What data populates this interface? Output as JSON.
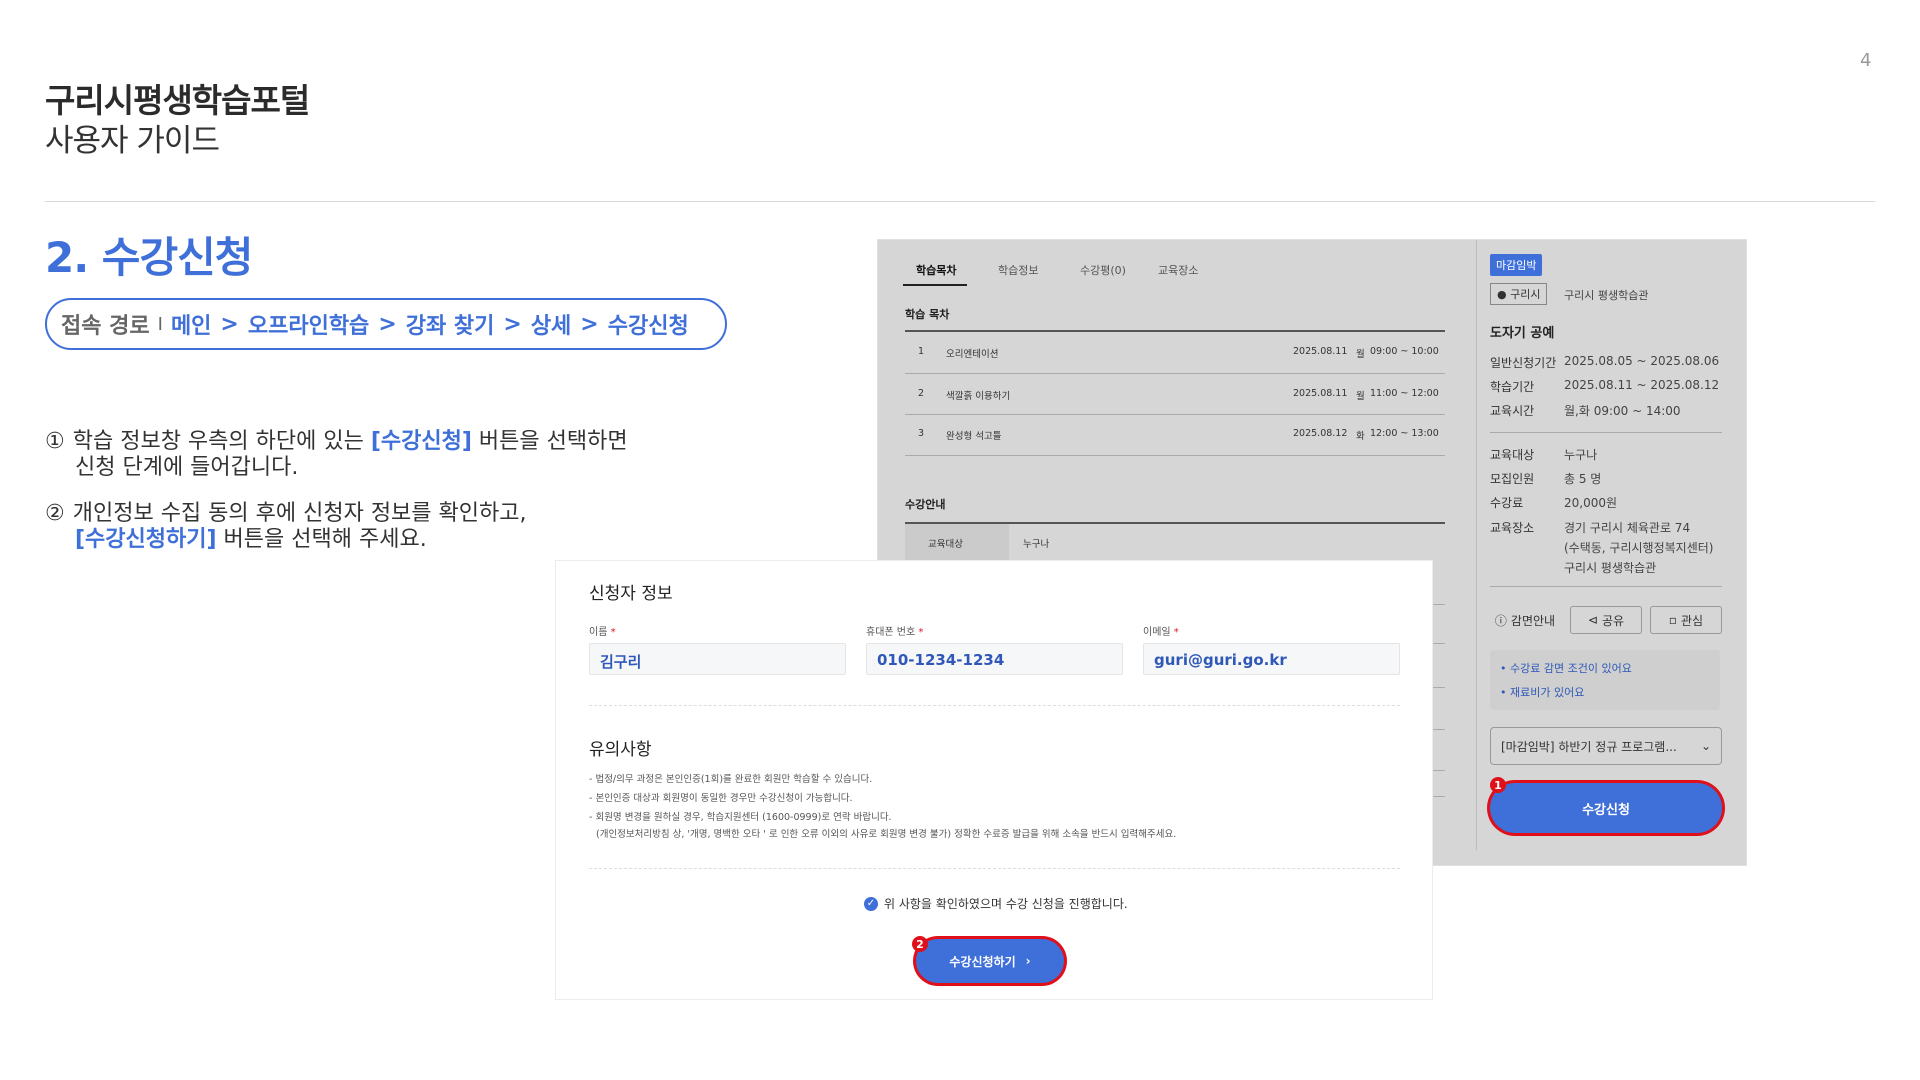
{
  "page_number": "4",
  "header": {
    "title": "구리시평생학습포털",
    "subtitle": "사용자 가이드"
  },
  "section": {
    "title": "2. 수강신청",
    "path_label": "접속 경로",
    "path_separator": "I",
    "path_items": [
      "메인",
      "오프라인학습",
      "강좌 찾기",
      "상세",
      "수강신청"
    ],
    "path_arrow": ">"
  },
  "steps": [
    {
      "marker": "①",
      "line1_before": "학습 정보창 우측의 하단에 있는 ",
      "line1_highlight": "[수강신청]",
      "line1_after": " 버튼을 선택하면",
      "line2": "신청 단계에 들어갑니다."
    },
    {
      "marker": "②",
      "line1": "개인정보 수집 동의 후에 신청자 정보를 확인하고,",
      "line2_highlight": "[수강신청하기]",
      "line2_after": " 버튼을 선택해 주세요."
    }
  ],
  "course_detail": {
    "tabs": [
      "학습목차",
      "학습정보",
      "수강평(0)",
      "교육장소"
    ],
    "toc_heading": "학습 목차",
    "toc_rows": [
      {
        "no": "1",
        "title": "오리엔테이션",
        "date": "2025.08.11",
        "day": "월",
        "time": "09:00 ~ 10:00"
      },
      {
        "no": "2",
        "title": "색깔흙 이용하기",
        "date": "2025.08.11",
        "day": "월",
        "time": "11:00 ~ 12:00"
      },
      {
        "no": "3",
        "title": "완성형 석고틀",
        "date": "2025.08.12",
        "day": "화",
        "time": "12:00 ~ 13:00"
      }
    ],
    "guide_heading": "수강안내",
    "guide_first_row": {
      "key": "교육대상",
      "value": "누구나"
    }
  },
  "side_panel": {
    "badge": "마감임박",
    "location_tag": "구리시",
    "institution": "구리시 평생학습관",
    "course_title": "도자기 공예",
    "schedule": [
      {
        "key": "일반신청기간",
        "value": "2025.08.05 ~ 2025.08.06"
      },
      {
        "key": "학습기간",
        "value": "2025.08.11 ~ 2025.08.12"
      },
      {
        "key": "교육시간",
        "value": "월,화 09:00 ~ 14:00"
      }
    ],
    "info": [
      {
        "key": "교육대상",
        "value": "누구나"
      },
      {
        "key": "모집인원",
        "value": "총 5 명"
      },
      {
        "key": "수강료",
        "value": "20,000원"
      }
    ],
    "place_key": "교육장소",
    "place_lines": [
      "경기 구리시 체육관로 74",
      "(수택동, 구리시행정복지센터)",
      "구리시 평생학습관"
    ],
    "buttons": {
      "discount": "감면안내",
      "share": "공유",
      "interest": "관심"
    },
    "notices": [
      "수강료 감면 조건이 있어요",
      "재료비가 있어요"
    ],
    "program_select": "[마감임박] 하반기 정규 프로그램...",
    "apply_label": "수강신청",
    "apply_marker": "1"
  },
  "applicant_form": {
    "title": "신청자 정보",
    "fields": [
      {
        "label": "이름",
        "value": "김구리"
      },
      {
        "label": "휴대폰 번호",
        "value": "010-1234-1234"
      },
      {
        "label": "이메일",
        "value": "guri@guri.go.kr"
      }
    ],
    "required_mark": "*",
    "notice_title": "유의사항",
    "notices": [
      "- 법정/의무 과정은 본인인증(1회)를 완료한 회원만 학습할 수 있습니다.",
      "- 본인인증 대상과 회원명이 동일한 경우만 수강신청이 가능합니다.",
      "- 회원명 변경을 원하실 경우, 학습지원센터 (1600-0999)로 연락 바랍니다.",
      "(개인정보처리방침 상, '개명, 명백한 오타 ' 로 인한 오류 이외의 사유로 회원명 변경 불가) 정확한 수료증 발급을 위해 소속을 반드시 입력해주세요."
    ],
    "agree_text": "위 사항을 확인하였으며 수강 신청을 진행합니다.",
    "submit_label": "수강신청하기",
    "submit_marker": "2"
  },
  "colors": {
    "accent": "#3f6fd8",
    "highlight_ring": "#e0101a"
  }
}
